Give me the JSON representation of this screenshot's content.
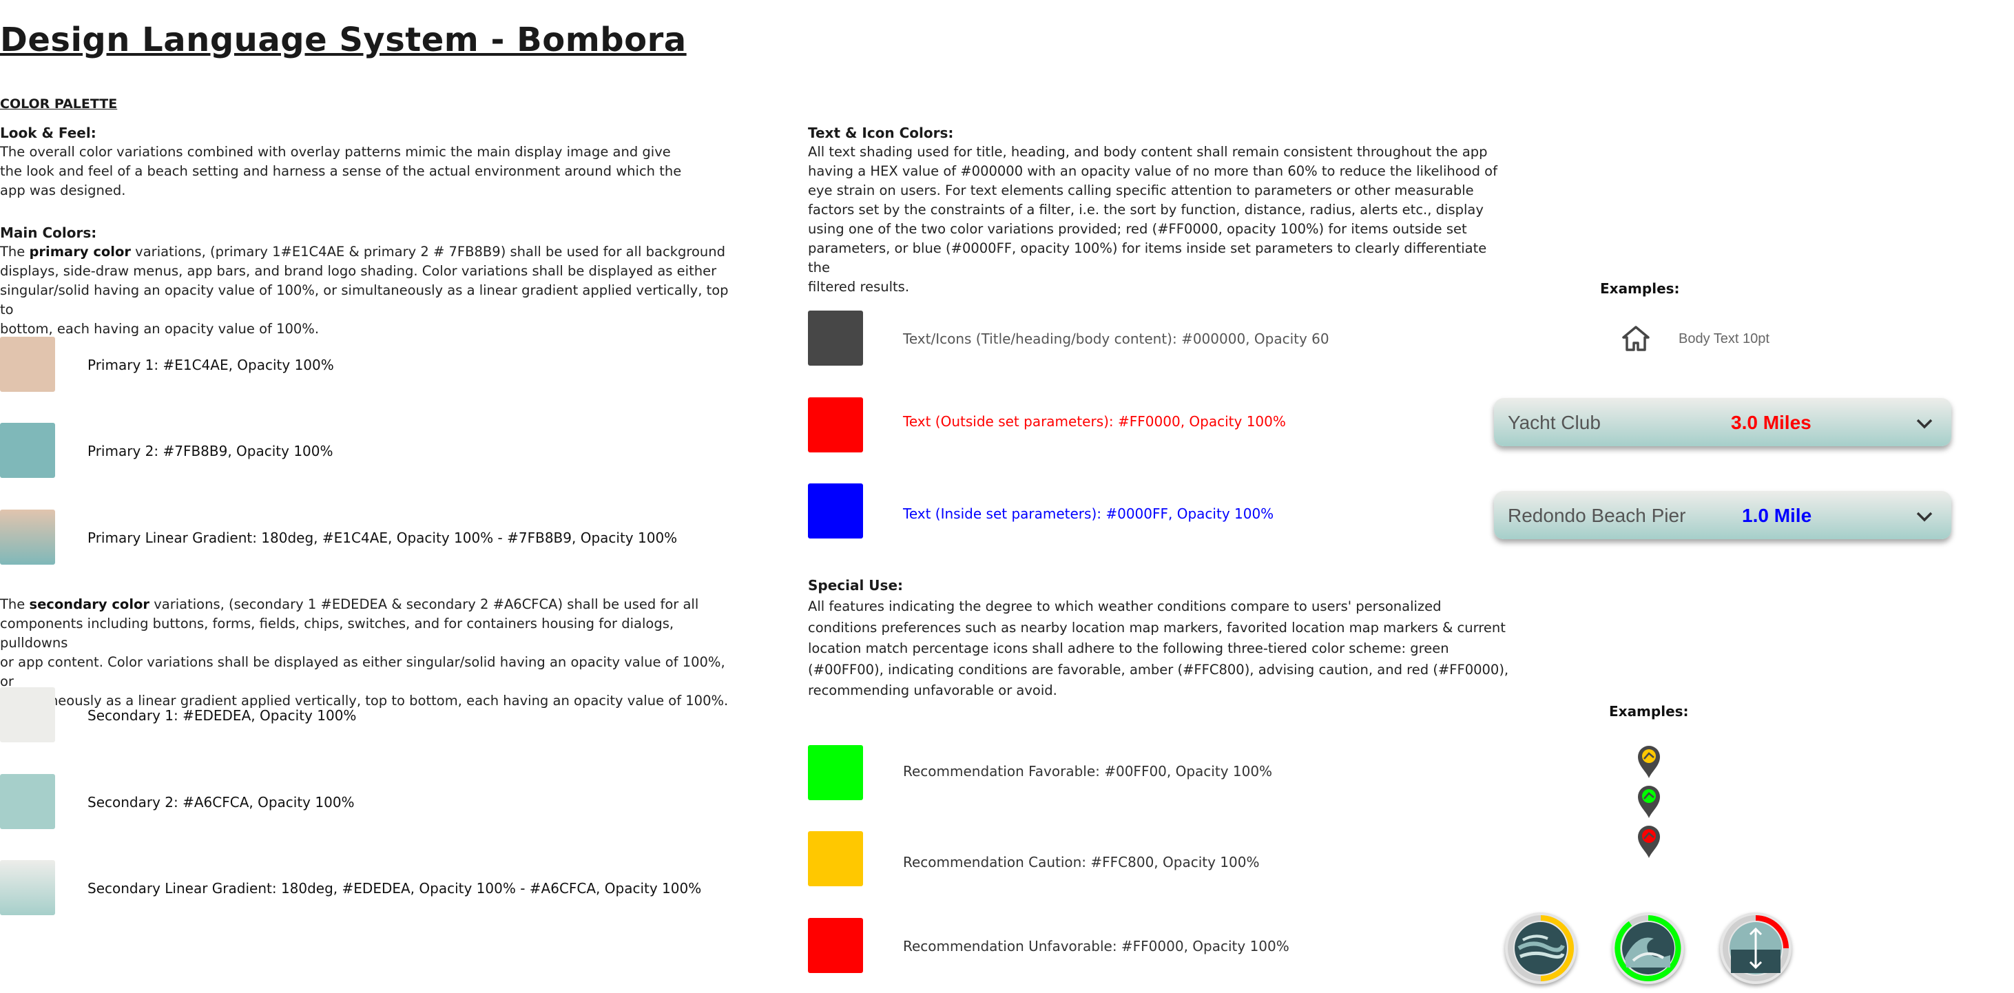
{
  "title": "Design Language System - Bombora",
  "color_palette_label": "COLOR PALETTE",
  "look_feel": {
    "heading": "Look & Feel:",
    "lines": [
      "The overall color variations combined with overlay patterns mimic the main display image and give",
      "the look and feel of a beach setting and harness a sense of the actual environment around which the",
      "app was designed."
    ]
  },
  "main_colors": {
    "heading": "Main Colors:",
    "line1_prefix": "The ",
    "line1_bold": "primary color",
    "line1_suffix": " variations, (primary 1#E1C4AE & primary 2 # 7FB8B9) shall be used for all background",
    "lines": [
      "displays, side-draw menus, app bars, and brand logo shading. Color variations shall be displayed as either",
      "singular/solid having an opacity value of 100%, or simultaneously as a linear gradient applied vertically, top to",
      "bottom, each having an opacity value of 100%."
    ]
  },
  "primary_swatches": [
    {
      "label": "Primary 1: #E1C4AE, Opacity 100%",
      "color": "#E1C4AE"
    },
    {
      "label": "Primary 2: #7FB8B9, Opacity 100%",
      "color": "#7FB8B9"
    },
    {
      "label": "Primary Linear Gradient: 180deg, #E1C4AE, Opacity 100% - #7FB8B9, Opacity 100%",
      "color": "#E1C4AE",
      "color2": "#7FB8B9"
    }
  ],
  "secondary": {
    "line1_prefix": "The ",
    "line1_bold": "secondary color",
    "line1_suffix": " variations, (secondary 1 #EDEDEA & secondary 2 #A6CFCA) shall be used for all",
    "lines": [
      "components including buttons, forms, fields, chips, switches, and for containers housing for dialogs, pulldowns",
      "or app content. Color variations shall be displayed as either singular/solid having an opacity value of 100%, or",
      "simultaneously as a linear gradient applied vertically, top to bottom, each having an opacity value of 100%."
    ]
  },
  "secondary_swatches": [
    {
      "label": "Secondary 1: #EDEDEA, Opacity 100%",
      "color": "#EDEDEA"
    },
    {
      "label": "Secondary 2: #A6CFCA, Opacity 100%",
      "color": "#A6CFCA"
    },
    {
      "label": "Secondary Linear Gradient: 180deg, #EDEDEA, Opacity 100% - #A6CFCA, Opacity 100%",
      "color": "#EDEDEA",
      "color2": "#A6CFCA"
    }
  ],
  "text_icon": {
    "heading": "Text & Icon Colors:",
    "lines": [
      "All text shading used for title, heading, and body content shall remain consistent throughout the app",
      "having a HEX value of #000000 with an opacity value of no more than 60% to reduce the likelihood of",
      "eye strain on users. For text elements calling specific attention to parameters or other measurable",
      "factors set by the constraints of a filter, i.e. the sort by function, distance, radius, alerts etc., display",
      "using one of the two color variations provided; red (#FF0000, opacity 100%) for items outside set",
      "parameters, or blue (#0000FF, opacity 100%) for items inside set parameters to clearly differentiate the",
      "filtered results."
    ]
  },
  "text_swatches": [
    {
      "label": "Text/Icons (Title/heading/body content): #000000, Opacity 60",
      "color": "#474747"
    },
    {
      "label": "Text (Outside set parameters): #FF0000, Opacity 100%",
      "color": "#FF0000"
    },
    {
      "label": "Text (Inside set parameters): #0000FF, Opacity 100%",
      "color": "#0000FF"
    }
  ],
  "special": {
    "heading": "Special Use:",
    "lines": [
      "All features indicating the degree to which weather conditions compare to users' personalized",
      "conditions preferences such as nearby location map markers, favorited location map markers & current",
      "location match percentage icons shall adhere to the following three-tiered color scheme: green",
      "(#00FF00), indicating conditions are favorable, amber (#FFC800), advising caution, and red (#FF0000),",
      "recommending unfavorable or avoid."
    ]
  },
  "rec_swatches": [
    {
      "label": "Recommendation Favorable: #00FF00, Opacity 100%",
      "color": "#00FF00"
    },
    {
      "label": "Recommendation Caution: #FFC800, Opacity 100%",
      "color": "#FFC800"
    },
    {
      "label": "Recommendation Unfavorable: #FF0000, Opacity 100%",
      "color": "#FF0000"
    }
  ],
  "examples1": {
    "heading": "Examples:",
    "icon": "home-icon",
    "body_text": "Body Text 10pt",
    "dropdowns": [
      {
        "name": "Yacht Club",
        "distance": "3.0 Miles",
        "distance_color": "#FF0000"
      },
      {
        "name": "Redondo Beach Pier",
        "distance": "1.0 Mile",
        "distance_color": "#0000FF"
      }
    ]
  },
  "examples2": {
    "heading": "Examples:",
    "markers": [
      {
        "icon": "surfer-marker-icon",
        "color": "#FFC800"
      },
      {
        "icon": "surfer-marker-icon",
        "color": "#00FF00"
      },
      {
        "icon": "surfer-marker-icon",
        "color": "#FF0000"
      }
    ],
    "match_icons": [
      {
        "icon": "wind-match-icon",
        "color": "#FFC800",
        "fraction": 0.5
      },
      {
        "icon": "wave-match-icon",
        "color": "#00FF00",
        "fraction": 0.9
      },
      {
        "icon": "tide-match-icon",
        "color": "#FF0000",
        "fraction": 0.25
      }
    ]
  }
}
